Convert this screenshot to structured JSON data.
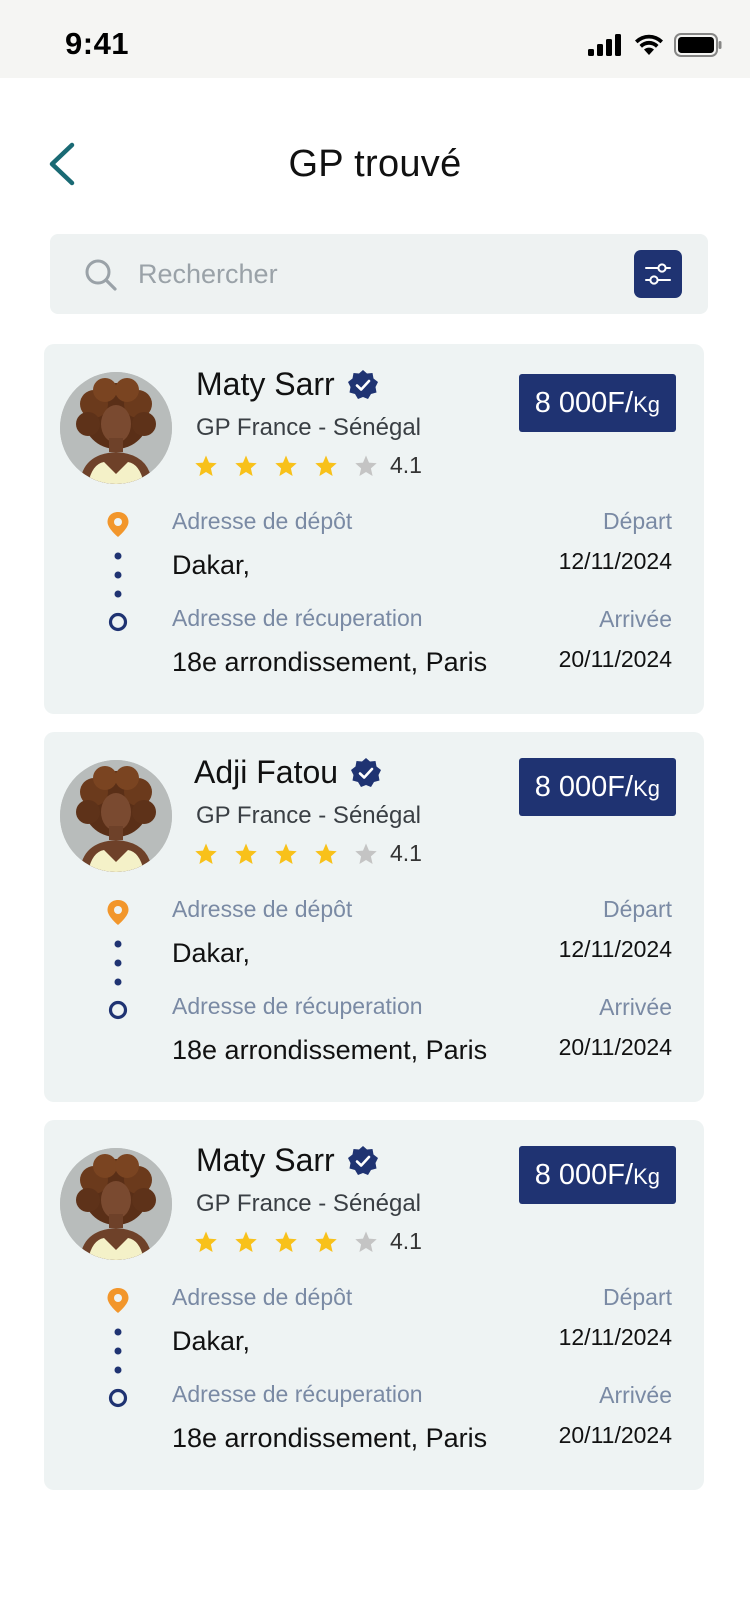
{
  "status_bar": {
    "time": "9:41"
  },
  "header": {
    "title": "GP trouvé"
  },
  "search": {
    "placeholder": "Rechercher"
  },
  "colors": {
    "brand": "#1f3372",
    "accent_teal": "#1a6a74",
    "pin_orange": "#f2962b",
    "star_yellow": "#f8c11a",
    "star_grey": "#c4c4c4"
  },
  "cards": [
    {
      "name": "Maty Sarr",
      "route": "GP France - Sénégal",
      "rating": "4.1",
      "stars_filled": 4,
      "price": "8 000F/",
      "price_unit": "Kg",
      "pickup_label": "Adresse de dépôt",
      "pickup_value": "Dakar,",
      "dropoff_label": "Adresse de récuperation",
      "dropoff_value": "18e arrondissement, Paris",
      "depart_label": "Départ",
      "depart_date": "12/11/2024",
      "arrival_label": "Arrivée",
      "arrival_date": "20/11/2024"
    },
    {
      "name": "Adji Fatou",
      "route": "GP France - Sénégal",
      "rating": "4.1",
      "stars_filled": 4,
      "price": "8 000F/",
      "price_unit": "Kg",
      "pickup_label": "Adresse de dépôt",
      "pickup_value": "Dakar,",
      "dropoff_label": "Adresse de récuperation",
      "dropoff_value": "18e arrondissement, Paris",
      "depart_label": "Départ",
      "depart_date": "12/11/2024",
      "arrival_label": "Arrivée",
      "arrival_date": "20/11/2024"
    },
    {
      "name": "Maty Sarr",
      "route": "GP France - Sénégal",
      "rating": "4.1",
      "stars_filled": 4,
      "price": "8 000F/",
      "price_unit": "Kg",
      "pickup_label": "Adresse de dépôt",
      "pickup_value": "Dakar,",
      "dropoff_label": "Adresse de récuperation",
      "dropoff_value": "18e arrondissement, Paris",
      "depart_label": "Départ",
      "depart_date": "12/11/2024",
      "arrival_label": "Arrivée",
      "arrival_date": "20/11/2024"
    }
  ]
}
